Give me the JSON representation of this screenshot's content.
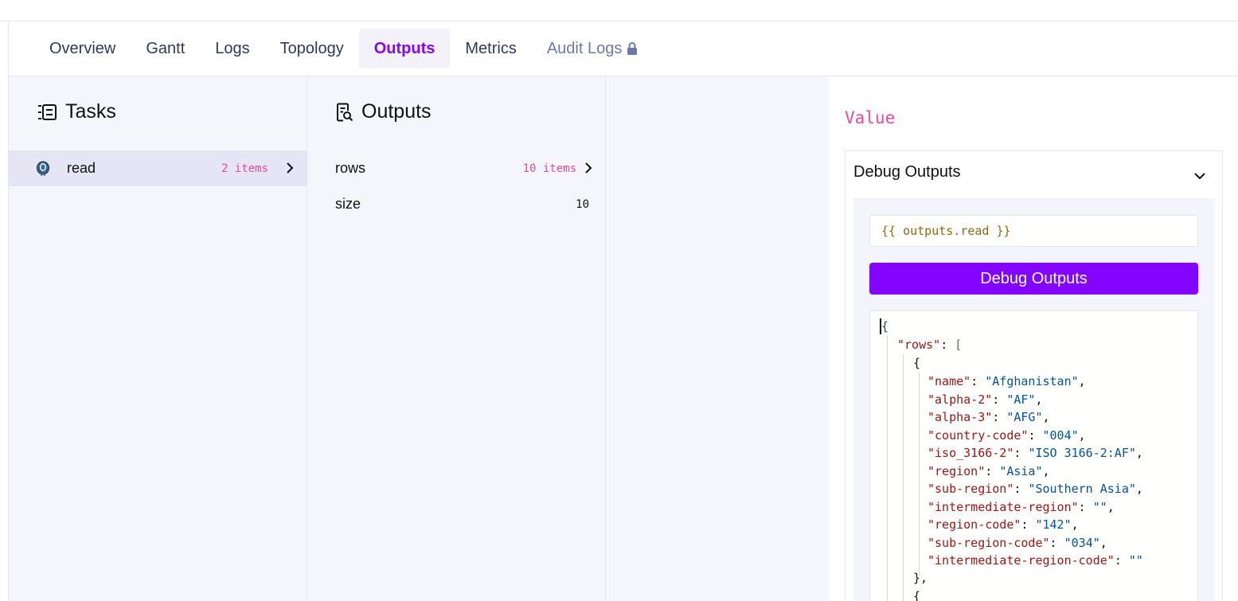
{
  "tabs": [
    {
      "label": "Overview"
    },
    {
      "label": "Gantt"
    },
    {
      "label": "Logs"
    },
    {
      "label": "Topology"
    },
    {
      "label": "Outputs"
    },
    {
      "label": "Metrics"
    },
    {
      "label": "Audit Logs"
    }
  ],
  "accent_color": "#8405ff",
  "tasks": {
    "title": "Tasks",
    "items": [
      {
        "name": "read",
        "count": "2 items"
      }
    ]
  },
  "outputs": {
    "title": "Outputs",
    "items": [
      {
        "name": "rows",
        "count": "10 items"
      },
      {
        "name": "size",
        "value": "10"
      }
    ]
  },
  "value_panel": {
    "title": "Value",
    "debug": {
      "header": "Debug Outputs",
      "expression": "{{ outputs.read }}",
      "button_label": "Debug Outputs",
      "json": {
        "open_brace": "{",
        "rows_key": "\"rows\"",
        "colon": ": ",
        "rows_bracket": "[",
        "obj_open": "{",
        "obj_close": "},",
        "fields": [
          {
            "key": "\"name\"",
            "value": "\"Afghanistan\"",
            "comma": ","
          },
          {
            "key": "\"alpha-2\"",
            "value": "\"AF\"",
            "comma": ","
          },
          {
            "key": "\"alpha-3\"",
            "value": "\"AFG\"",
            "comma": ","
          },
          {
            "key": "\"country-code\"",
            "value": "\"004\"",
            "comma": ","
          },
          {
            "key": "\"iso_3166-2\"",
            "value": "\"ISO 3166-2:AF\"",
            "comma": ","
          },
          {
            "key": "\"region\"",
            "value": "\"Asia\"",
            "comma": ","
          },
          {
            "key": "\"sub-region\"",
            "value": "\"Southern Asia\"",
            "comma": ","
          },
          {
            "key": "\"intermediate-region\"",
            "value": "\"\"",
            "comma": ","
          },
          {
            "key": "\"region-code\"",
            "value": "\"142\"",
            "comma": ","
          },
          {
            "key": "\"sub-region-code\"",
            "value": "\"034\"",
            "comma": ","
          },
          {
            "key": "\"intermediate-region-code\"",
            "value": "\"\"",
            "comma": ""
          }
        ]
      }
    }
  }
}
